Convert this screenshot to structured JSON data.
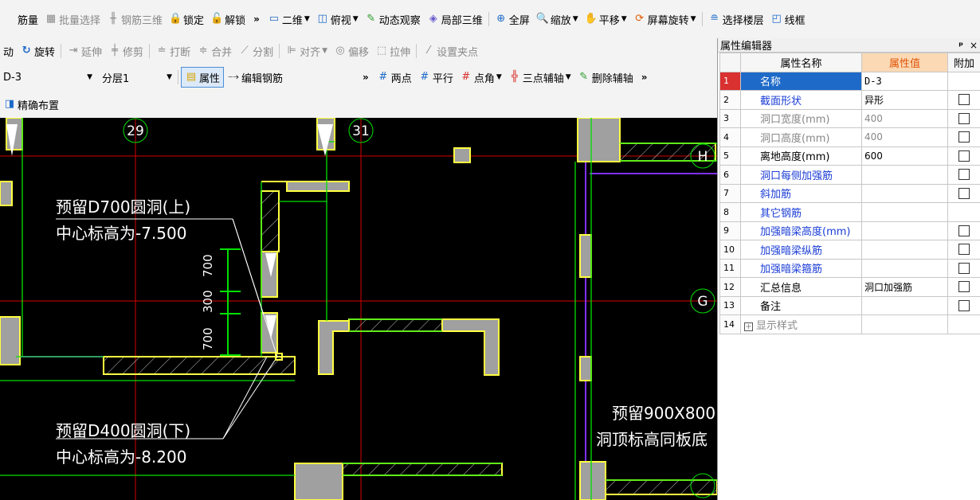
{
  "toolbar_top": {
    "items": [
      {
        "label": "筋量",
        "icon": "rebar-qty-icon",
        "disabled": false
      },
      {
        "label": "批量选择",
        "icon": "batch-select-icon",
        "disabled": true
      },
      {
        "label": "钢筋三维",
        "icon": "rebar-3d-icon",
        "disabled": true
      },
      {
        "label": "锁定",
        "icon": "lock-icon",
        "disabled": false
      },
      {
        "label": "解锁",
        "icon": "unlock-icon",
        "disabled": false
      }
    ],
    "more": "»",
    "view_items": [
      {
        "label": "二维",
        "icon": "2d-view-icon",
        "dropdown": true
      },
      {
        "label": "俯视",
        "icon": "top-view-icon",
        "dropdown": true
      },
      {
        "label": "动态观察",
        "icon": "orbit-icon",
        "dropdown": false
      },
      {
        "label": "局部三维",
        "icon": "local-3d-icon",
        "dropdown": false
      },
      {
        "label": "全屏",
        "icon": "fullscreen-icon",
        "dropdown": false
      },
      {
        "label": "缩放",
        "icon": "zoom-icon",
        "dropdown": true
      },
      {
        "label": "平移",
        "icon": "pan-icon",
        "dropdown": true
      },
      {
        "label": "屏幕旋转",
        "icon": "screen-rotate-icon",
        "dropdown": true
      },
      {
        "label": "选择楼层",
        "icon": "select-floor-icon",
        "dropdown": false
      },
      {
        "label": "线框",
        "icon": "wireframe-icon",
        "dropdown": false
      }
    ]
  },
  "toolbar_edit": {
    "items": [
      {
        "label": "动",
        "icon": "",
        "disabled": false
      },
      {
        "label": "旋转",
        "icon": "rotate-icon",
        "disabled": false
      },
      {
        "label": "延伸",
        "icon": "extend-icon",
        "disabled": true
      },
      {
        "label": "修剪",
        "icon": "trim-icon",
        "disabled": true
      },
      {
        "label": "打断",
        "icon": "break-icon",
        "disabled": true
      },
      {
        "label": "合并",
        "icon": "merge-icon",
        "disabled": true
      },
      {
        "label": "分割",
        "icon": "split-icon",
        "disabled": true
      },
      {
        "label": "对齐",
        "icon": "align-icon",
        "disabled": true
      },
      {
        "label": "偏移",
        "icon": "offset-icon",
        "disabled": true
      },
      {
        "label": "拉伸",
        "icon": "stretch-icon",
        "disabled": true
      },
      {
        "label": "设置夹点",
        "icon": "grip-icon",
        "disabled": true
      }
    ]
  },
  "toolbar_prop": {
    "component": "D-3",
    "layer": "分层1",
    "property_btn": "属性",
    "edit_rebar_btn": "编辑钢筋",
    "more": "»",
    "axis_items": [
      {
        "label": "两点",
        "icon": "two-point-axis-icon",
        "dropdown": false
      },
      {
        "label": "平行",
        "icon": "parallel-axis-icon",
        "dropdown": false
      },
      {
        "label": "点角",
        "icon": "point-angle-axis-icon",
        "dropdown": true
      },
      {
        "label": "三点辅轴",
        "icon": "three-point-axis-icon",
        "dropdown": true
      },
      {
        "label": "删除辅轴",
        "icon": "delete-axis-icon",
        "dropdown": false
      }
    ],
    "more2": "»"
  },
  "toolbar_place": {
    "label": "精确布置"
  },
  "canvas": {
    "axis_labels": [
      "29",
      "31",
      "H",
      "G"
    ],
    "annot_top_line1": "预留D700圆洞(上)",
    "annot_top_line2": "中心标高为-7.500",
    "annot_bot_line1": "预留D400圆洞(下)",
    "annot_bot_line2": "中心标高为-8.200",
    "annot_right_line1": "预留900X800",
    "annot_right_line2": "洞顶标高同板底",
    "dims": [
      "700",
      "300",
      "700"
    ],
    "colors": {
      "background": "#000000",
      "axis": "#d40000",
      "wall": "#00e000",
      "column": "#ffff40",
      "fill": "#a0a0a0",
      "beam": "#8030ff"
    }
  },
  "panel": {
    "title": "属性编辑器",
    "pin": "ᵖ",
    "close": "×",
    "columns": {
      "name": "属性名称",
      "value": "属性值",
      "extra": "附加"
    },
    "rows": [
      {
        "no": "1",
        "name": "名称",
        "value": "D-3",
        "style": "sel",
        "checkbox": false
      },
      {
        "no": "2",
        "name": "截面形状",
        "value": "异形",
        "style": "blue",
        "checkbox": true
      },
      {
        "no": "3",
        "name": "洞口宽度(mm)",
        "value": "400",
        "style": "gray",
        "checkbox": true
      },
      {
        "no": "4",
        "name": "洞口高度(mm)",
        "value": "400",
        "style": "gray",
        "checkbox": true
      },
      {
        "no": "5",
        "name": "离地高度(mm)",
        "value": "600",
        "style": "black",
        "checkbox": true
      },
      {
        "no": "6",
        "name": "洞口每侧加强筋",
        "value": "",
        "style": "blue",
        "checkbox": true
      },
      {
        "no": "7",
        "name": "斜加筋",
        "value": "",
        "style": "blue",
        "checkbox": true
      },
      {
        "no": "8",
        "name": "其它钢筋",
        "value": "",
        "style": "blue",
        "checkbox": false
      },
      {
        "no": "9",
        "name": "加强暗梁高度(mm)",
        "value": "",
        "style": "blue",
        "checkbox": true
      },
      {
        "no": "10",
        "name": "加强暗梁纵筋",
        "value": "",
        "style": "blue",
        "checkbox": true
      },
      {
        "no": "11",
        "name": "加强暗梁箍筋",
        "value": "",
        "style": "blue",
        "checkbox": true
      },
      {
        "no": "12",
        "name": "汇总信息",
        "value": "洞口加强筋",
        "style": "black",
        "checkbox": true
      },
      {
        "no": "13",
        "name": "备注",
        "value": "",
        "style": "black",
        "checkbox": true
      },
      {
        "no": "14",
        "name": "显示样式",
        "value": "",
        "style": "group",
        "checkbox": false
      }
    ]
  }
}
